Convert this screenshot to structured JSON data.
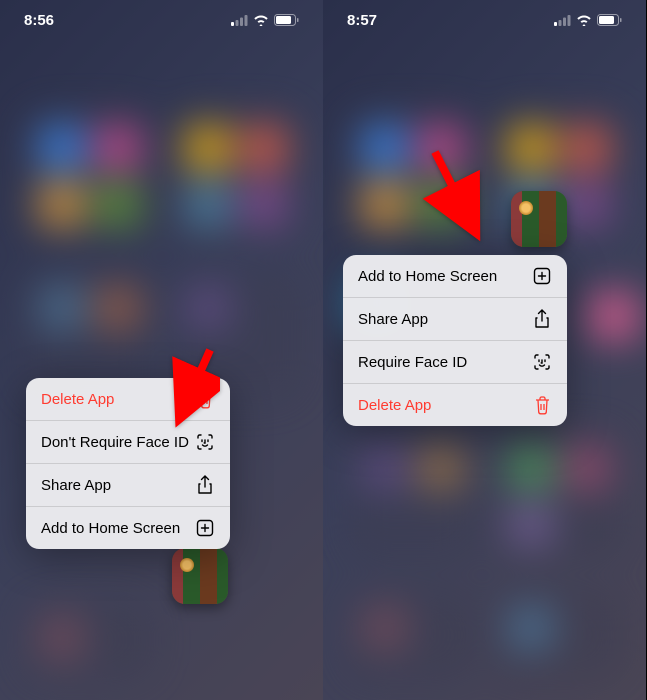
{
  "left": {
    "time": "8:56",
    "menu": {
      "delete": "Delete App",
      "faceid": "Don't Require Face ID",
      "share": "Share App",
      "home": "Add to Home Screen"
    }
  },
  "right": {
    "time": "8:57",
    "menu": {
      "home": "Add to Home Screen",
      "share": "Share App",
      "faceid": "Require Face ID",
      "delete": "Delete App"
    }
  },
  "colors": {
    "destructive": "#ff3b30",
    "arrow": "#ff0000"
  }
}
